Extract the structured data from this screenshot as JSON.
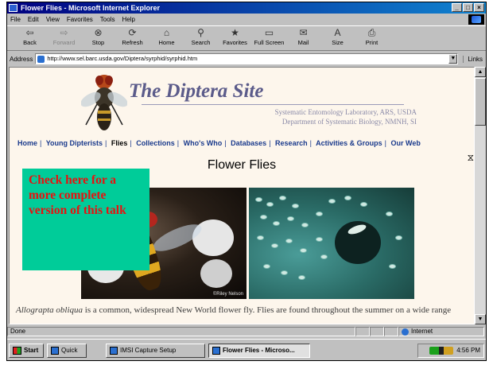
{
  "window": {
    "title": "Flower Flies - Microsoft Internet Explorer",
    "controls": [
      "_",
      "□",
      "×"
    ]
  },
  "menu": [
    "File",
    "Edit",
    "View",
    "Favorites",
    "Tools",
    "Help"
  ],
  "toolbar": [
    {
      "label": "Back",
      "icon": "back-arrow-icon",
      "glyph": "⇦"
    },
    {
      "label": "Forward",
      "icon": "forward-arrow-icon",
      "glyph": "⇨"
    },
    {
      "label": "Stop",
      "icon": "stop-icon",
      "glyph": "⊗"
    },
    {
      "label": "Refresh",
      "icon": "refresh-icon",
      "glyph": "⟳"
    },
    {
      "label": "Home",
      "icon": "home-icon",
      "glyph": "⌂"
    },
    {
      "label": "Search",
      "icon": "search-icon",
      "glyph": "⚲"
    },
    {
      "label": "Favorites",
      "icon": "favorites-icon",
      "glyph": "★"
    },
    {
      "label": "Full Screen",
      "icon": "fullscreen-icon",
      "glyph": "▭"
    },
    {
      "label": "Mail",
      "icon": "mail-icon",
      "glyph": "✉"
    },
    {
      "label": "Size",
      "icon": "font-size-icon",
      "glyph": "A"
    },
    {
      "label": "Print",
      "icon": "print-icon",
      "glyph": "⎙"
    }
  ],
  "address": {
    "label": "Address",
    "url": "http://www.sel.barc.usda.gov/Diptera/syrphid/syrphid.htm",
    "links_label": "Links"
  },
  "site": {
    "title": "The Diptera Site",
    "subtitle1": "Systematic Entomology Laboratory, ARS, USDA",
    "subtitle2": "Department of Systematic Biology, NMNH, SI"
  },
  "nav": [
    {
      "label": "Home"
    },
    {
      "label": "Young Dipterists"
    },
    {
      "label": "Flies",
      "current": true
    },
    {
      "label": "Collections"
    },
    {
      "label": "Who's Who"
    },
    {
      "label": "Databases"
    },
    {
      "label": "Research"
    },
    {
      "label": "Activities & Groups"
    },
    {
      "label": "Our Web"
    }
  ],
  "page": {
    "heading": "Flower Flies",
    "photo_credit": "©Riley Nelson",
    "caption_species": "Allograpta obliqua",
    "caption_text": " is a common, widespread New World flower fly. Flies are found throughout the summer on a wide range"
  },
  "callout": {
    "text": "Check here for a more complete version of this talk",
    "bg_color": "#00cc99",
    "text_color": "#e8110f"
  },
  "status": {
    "text": "Done",
    "zone": "Internet"
  },
  "taskbar": {
    "start": "Start",
    "quick": "Quick",
    "imsi": "IMSI Capture Setup",
    "ie": "Flower Flies - Microso...",
    "clock": "4:56 PM"
  }
}
